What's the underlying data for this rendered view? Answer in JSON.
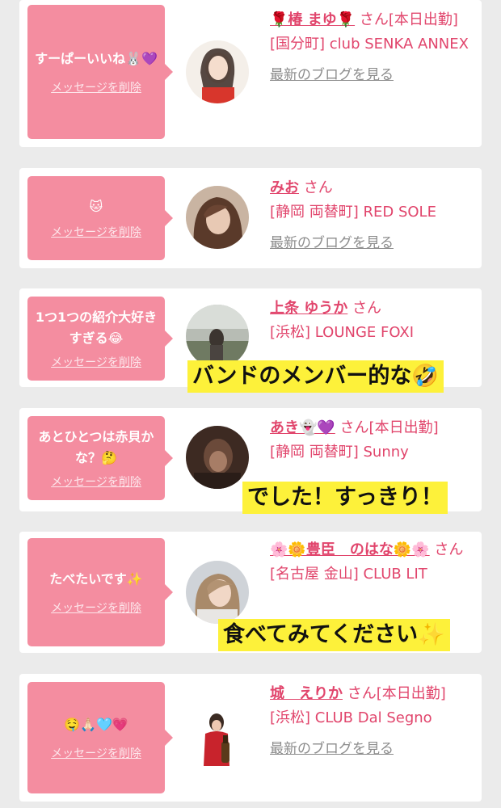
{
  "delete_label": "メッセージを削除",
  "blog_label": "最新のブログを見る",
  "colors": {
    "background": "#ebebeb",
    "bubble": "#f48da0",
    "accent": "#e1456c",
    "caption_bg": "#fdf13a"
  },
  "cards": [
    {
      "message": "すーぱーいいね🐰💜",
      "name": "🌹椿 まゆ🌹",
      "san": "さん[本日出勤]",
      "shop": "[国分町] club SENKA ANNEX",
      "has_blog": true
    },
    {
      "message": "🐱",
      "name": "みお",
      "san": "さん",
      "shop": "[静岡 両替町] RED SOLE",
      "has_blog": true
    },
    {
      "message": "1つ1つの紹介大好きすぎる😂",
      "name": "上条 ゆうか",
      "san": "さん",
      "shop": "[浜松] LOUNGE FOXI",
      "has_blog": false,
      "caption": "バンドのメンバー的な🤣"
    },
    {
      "message": "あとひとつは赤貝かな？🤔",
      "name": "あき👻💜",
      "san": "さん[本日出勤]",
      "shop": "[静岡 両替町] Sunny",
      "has_blog": false,
      "caption": "でした！すっきり！"
    },
    {
      "message": "たべたいです✨",
      "name": "🌸🌼豊臣　のはな🌼🌸",
      "san": "さん",
      "shop": "[名古屋 金山] CLUB LIT",
      "has_blog": false,
      "caption": "食べてみてください✨"
    },
    {
      "message": "🤤🙏🏻🩵💗",
      "name": "城　えりか",
      "san": "さん[本日出勤]",
      "shop": "[浜松] CLUB Dal Segno",
      "has_blog": true
    }
  ]
}
